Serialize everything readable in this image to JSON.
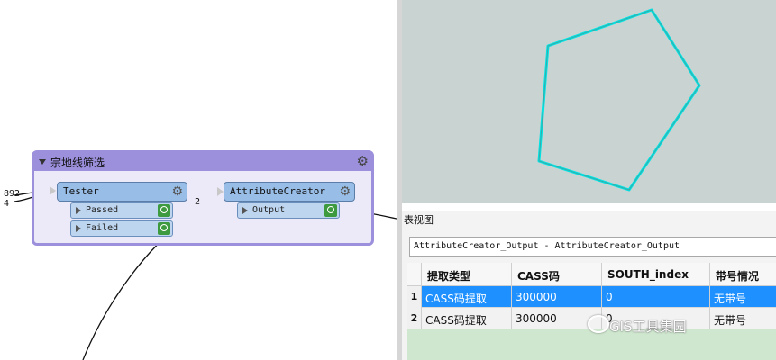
{
  "workspace": {
    "incoming_counts": [
      "892",
      "4"
    ],
    "bookmark": {
      "title": "宗地线筛选"
    },
    "tester": {
      "title": "Tester",
      "ports": [
        "Passed",
        "Failed"
      ]
    },
    "passed_count": "2",
    "attribute_creator": {
      "title": "AttributeCreator",
      "port": "Output"
    }
  },
  "viewer": {
    "polygon_color": "#00e5e5",
    "background": "#c8d3d2"
  },
  "table_view": {
    "title": "表视图",
    "dataset": "AttributeCreator_Output - AttributeCreator_Output",
    "columns": [
      "提取类型",
      "CASS码",
      "SOUTH_index",
      "带号情况"
    ],
    "rows": [
      {
        "num": "1",
        "cells": [
          "CASS码提取",
          "300000",
          "0",
          "无带号"
        ],
        "selected": true
      },
      {
        "num": "2",
        "cells": [
          "CASS码提取",
          "300000",
          "0",
          "无带号"
        ],
        "selected": false
      }
    ]
  },
  "watermark": "GIS工具集园"
}
